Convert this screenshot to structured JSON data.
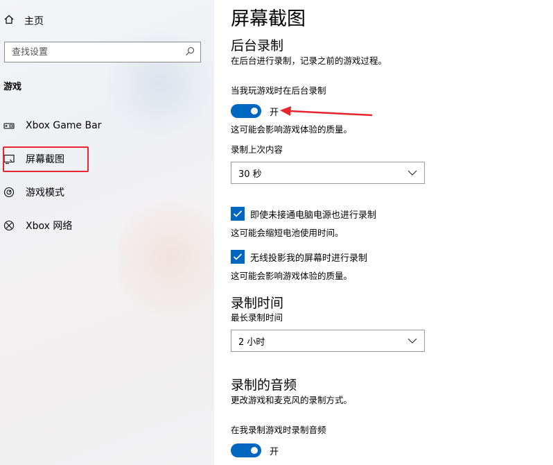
{
  "sidebar": {
    "home_label": "主页",
    "search_placeholder": "查找设置",
    "section": "游戏",
    "items": [
      {
        "label": "Xbox Game Bar",
        "icon": "game-bar-icon"
      },
      {
        "label": "屏幕截图",
        "icon": "captures-icon"
      },
      {
        "label": "游戏模式",
        "icon": "game-mode-icon"
      },
      {
        "label": "Xbox 网络",
        "icon": "xbox-icon"
      }
    ]
  },
  "main": {
    "title": "屏幕截图",
    "background_recording": {
      "heading": "后台录制",
      "description": "在后台进行录制，记录之前的游戏过程。",
      "toggle_label": "当我玩游戏时在后台录制",
      "toggle_state": "开",
      "toggle_note": "这可能会影响游戏体验的质量。",
      "record_last_label": "录制上次内容",
      "record_last_value": "30 秒",
      "battery_checkbox": "即使未接通电脑电源也进行录制",
      "battery_note": "这可能会缩短电池使用时间。",
      "wireless_checkbox": "无线投影我的屏幕时进行录制",
      "wireless_note": "这可能会影响游戏体验的质量。"
    },
    "recording_length": {
      "heading": "录制时间",
      "label": "最长录制时间",
      "value": "2 小时"
    },
    "recorded_audio": {
      "heading": "录制的音频",
      "description": "更改游戏和麦克风的录制方式。",
      "toggle_label": "在我录制游戏时录制音频",
      "toggle_state": "开"
    }
  },
  "colors": {
    "accent": "#0067c0",
    "annotation_red": "#e8242f"
  }
}
